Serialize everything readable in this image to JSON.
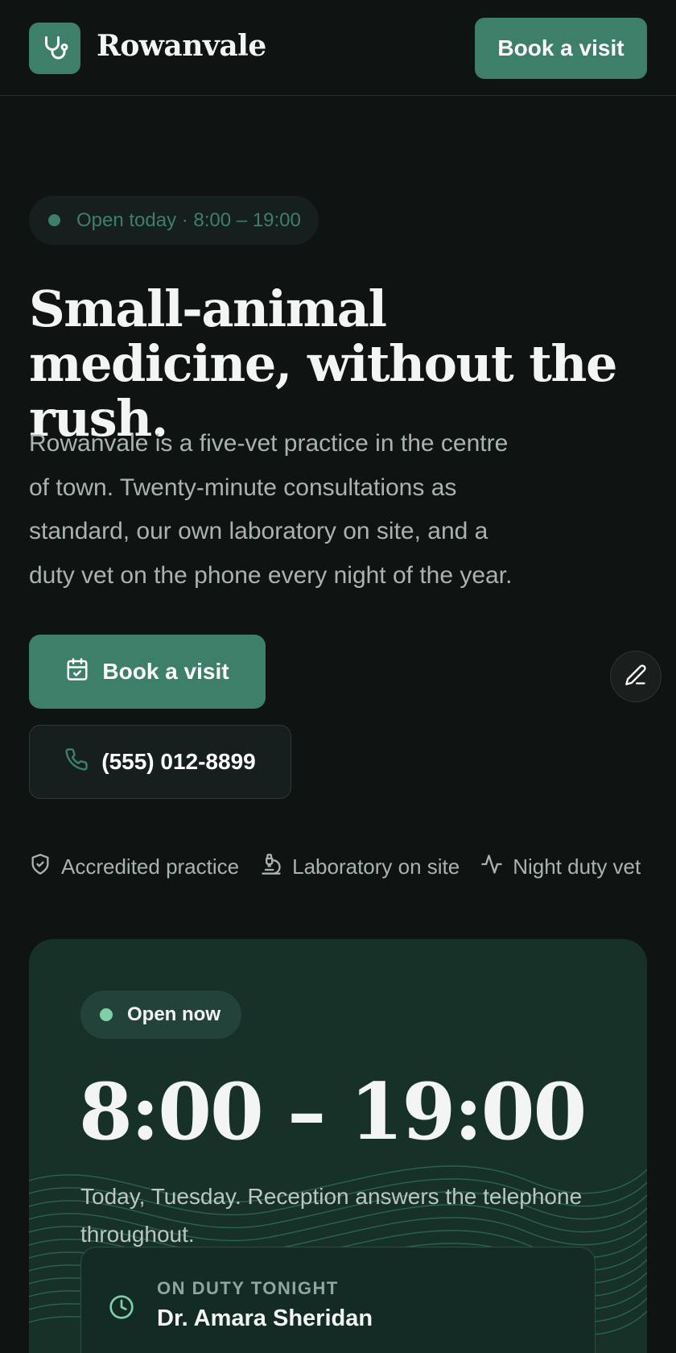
{
  "header": {
    "brand": "Rowanvale",
    "cta_label": "Book a visit",
    "logo_icon": "stethoscope-icon"
  },
  "hero": {
    "status_pill": "Open today · 8:00 – 19:00",
    "headline": "Small-animal medicine, without the rush.",
    "lede": "Rowanvale is a five-vet practice in the centre of town. Twenty-minute consultations as standard, our own laboratory on site, and a duty vet on the phone every night of the year.",
    "primary_cta": "Book a visit",
    "primary_cta_icon": "calendar-check-icon",
    "phone_cta": "(555) 012-8899",
    "phone_cta_icon": "phone-icon",
    "edit_icon": "pencil-icon"
  },
  "features": [
    {
      "label": "Accredited practice",
      "icon": "shield-check-icon"
    },
    {
      "label": "Laboratory on site",
      "icon": "microscope-icon"
    },
    {
      "label": "Night duty vet",
      "icon": "activity-icon"
    }
  ],
  "hours_card": {
    "status": "Open now",
    "hours": "8:00 – 19:00",
    "note": "Today, Tuesday. Reception answers the telephone throughout.",
    "duty_kicker": "ON DUTY TONIGHT",
    "duty_name": "Dr. Amara Sheridan",
    "duty_icon": "clock-icon"
  },
  "colors": {
    "background": "#0f1413",
    "accent": "#3d7f68",
    "card": "#173129",
    "status_dot": "#7fd0a8"
  }
}
